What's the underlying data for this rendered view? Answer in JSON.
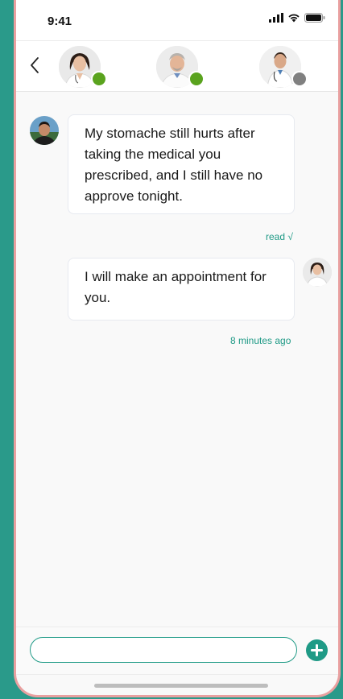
{
  "status_bar": {
    "time": "9:41",
    "signal_icon": "signal-icon",
    "wifi_icon": "wifi-icon",
    "battery_icon": "battery-icon"
  },
  "header": {
    "back_icon": "chevron-left-icon",
    "doctors": [
      {
        "avatar_icon": "female-doctor-avatar",
        "status": "online",
        "status_color": "#5aa31e"
      },
      {
        "avatar_icon": "male-doctor-avatar",
        "status": "online",
        "status_color": "#5aa31e"
      },
      {
        "avatar_icon": "male-doctor-avatar",
        "status": "offline",
        "status_color": "#808080"
      }
    ]
  },
  "messages": [
    {
      "sender": "patient",
      "text": "My stomache still hurts after taking the medical you prescribed, and I still have no approve tonight.",
      "meta": "read √"
    },
    {
      "sender": "doctor",
      "text": "I will make an appointment for you.",
      "meta": "8 minutes ago"
    }
  ],
  "composer": {
    "value": "",
    "placeholder": "",
    "add_icon": "plus-circle-icon"
  },
  "colors": {
    "accent": "#1f9a86",
    "online": "#5aa31e",
    "offline": "#808080",
    "background_frame": "#2a9a8a"
  }
}
